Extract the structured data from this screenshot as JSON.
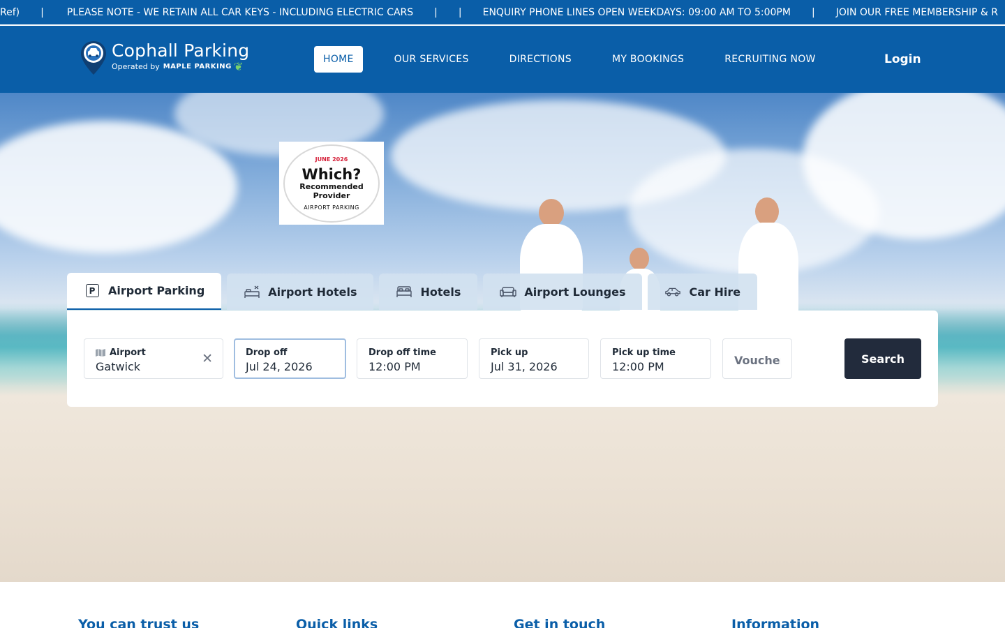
{
  "ticker": {
    "items": [
      "Ref)",
      "PLEASE NOTE - WE RETAIN ALL CAR KEYS - INCLUDING ELECTRIC CARS",
      "",
      "ENQUIRY PHONE LINES OPEN WEEKDAYS: 09:00 AM TO 5:00PM",
      "JOIN OUR FREE MEMBERSHIP & R"
    ],
    "separator": "|"
  },
  "header": {
    "logo_title": "Cophall Parking",
    "logo_operated": "Operated by",
    "logo_brand": "MAPLE PARKING",
    "nav": [
      "HOME",
      "OUR SERVICES",
      "DIRECTIONS",
      "MY BOOKINGS",
      "RECRUITING NOW"
    ],
    "login": "Login"
  },
  "badge": {
    "date": "JUNE 2026",
    "which": "Which?",
    "recommended": "Recommended",
    "provider": "Provider",
    "category": "AIRPORT PARKING"
  },
  "tabs": [
    {
      "label": "Airport Parking",
      "icon": "parking-icon"
    },
    {
      "label": "Airport Hotels",
      "icon": "airport-hotel-icon"
    },
    {
      "label": "Hotels",
      "icon": "bed-icon"
    },
    {
      "label": "Airport Lounges",
      "icon": "sofa-icon"
    },
    {
      "label": "Car Hire",
      "icon": "car-icon"
    }
  ],
  "search": {
    "airport_label": "Airport",
    "airport_value": "Gatwick",
    "dropoff_label": "Drop off",
    "dropoff_value": "Jul 24, 2026",
    "dropoff_time_label": "Drop off time",
    "dropoff_time_value": "12:00 PM",
    "pickup_label": "Pick up",
    "pickup_value": "Jul 31, 2026",
    "pickup_time_label": "Pick up time",
    "pickup_time_value": "12:00 PM",
    "voucher_placeholder": "Voucher",
    "search_label": "Search",
    "clear_symbol": "✕"
  },
  "footer": {
    "headings": [
      "You can trust us",
      "Quick links",
      "Get in touch",
      "Information"
    ]
  },
  "colors": {
    "brand_blue": "#0a5ea8",
    "search_button": "#222b3c",
    "footer_heading": "#0a5ea8"
  }
}
